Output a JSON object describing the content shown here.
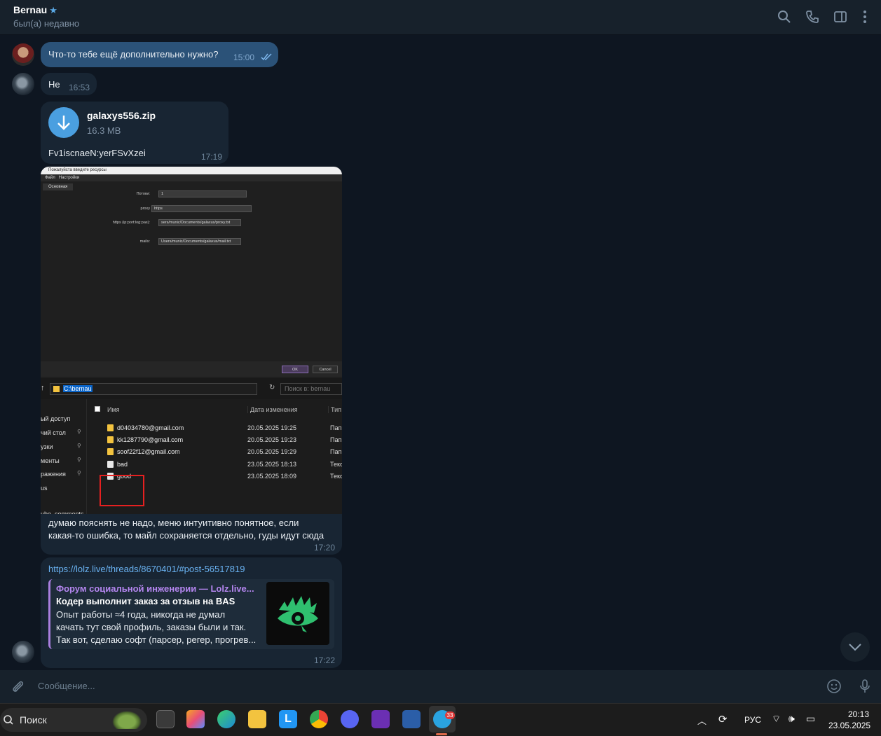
{
  "header": {
    "name": "Bernau",
    "status": "был(а) недавно",
    "icons": [
      "search-icon",
      "phone-icon",
      "sidebar-toggle-icon",
      "more-vertical-icon"
    ]
  },
  "messages": [
    {
      "direction": "out",
      "text": "Что-то тебе ещё дополнительно нужно?",
      "time": "15:00",
      "read": true
    },
    {
      "direction": "in",
      "text": "Не",
      "time": "16:53"
    },
    {
      "direction": "in",
      "file": {
        "name": "galaxys556.zip",
        "size": "16.3 MB"
      },
      "text": "Fv1iscnaeN:yerFSvXzei",
      "time": "17:19"
    },
    {
      "direction": "in",
      "text_line1": "думаю пояснять не надо, меню интуитивно понятное, если",
      "text_line2": "какая-то ошибка, то майл сохраняется отдельно, гуды идут сюда",
      "time": "17:20"
    },
    {
      "direction": "in",
      "link": "https://lolz.live/threads/8670401/#post-56517819",
      "preview": {
        "site": "Форум социальной инженерии — Lolz.live...",
        "title": "Кодер выполнит заказ за отзыв на BAS",
        "desc_line1": "Опыт работы ≈4 года, никогда не думал",
        "desc_line2": "качать тут свой профиль, заказы были и так.",
        "desc_line3": "Так вот, сделаю софт (парсер, регер, прогрев..."
      },
      "time": "17:22"
    }
  ],
  "screenshot": {
    "dialog": {
      "title": "Пожалуйста введите ресурсы",
      "menu_file": "Файл",
      "menu_settings": "Настройки",
      "tab": "Основная",
      "threads_label": "Потоки:",
      "threads_value": "1",
      "proxy_label": "proxy",
      "proxy_value": "https",
      "https_label": "https (ip:port:log:pas):",
      "https_value": "sers/munic/Documents/galaxus/proxy.txt",
      "mails_label": "mails:",
      "mails_value": "Users/munic/Documents/galaxus/mail.txt",
      "ok": "OK",
      "cancel": "Cancel"
    },
    "explorer": {
      "address": "C:\\bernau",
      "search_placeholder": "Поиск в: bernau",
      "col_name": "Имя",
      "col_date": "Дата изменения",
      "col_type": "Тип",
      "nav": [
        "ый доступ",
        "чий стол",
        "узки",
        "менты",
        "ражения",
        "us",
        "ube_comments"
      ],
      "rows": [
        {
          "name": "d04034780@gmail.com",
          "date": "20.05.2025 19:25",
          "type": "Пап",
          "kind": "folder"
        },
        {
          "name": "kk1287790@gmail.com",
          "date": "20.05.2025 19:23",
          "type": "Пап",
          "kind": "folder"
        },
        {
          "name": "soof22f12@gmail.com",
          "date": "20.05.2025 19:29",
          "type": "Пап",
          "kind": "folder"
        },
        {
          "name": "bad",
          "date": "23.05.2025 18:13",
          "type": "Текс",
          "kind": "doc"
        },
        {
          "name": "good",
          "date": "23.05.2025 18:09",
          "type": "Текс",
          "kind": "doc"
        }
      ]
    }
  },
  "composer": {
    "placeholder": "Сообщение..."
  },
  "taskbar": {
    "search": "Поиск",
    "language": "РУС",
    "time": "20:13",
    "date": "23.05.2025",
    "telegram_badge": "33"
  }
}
